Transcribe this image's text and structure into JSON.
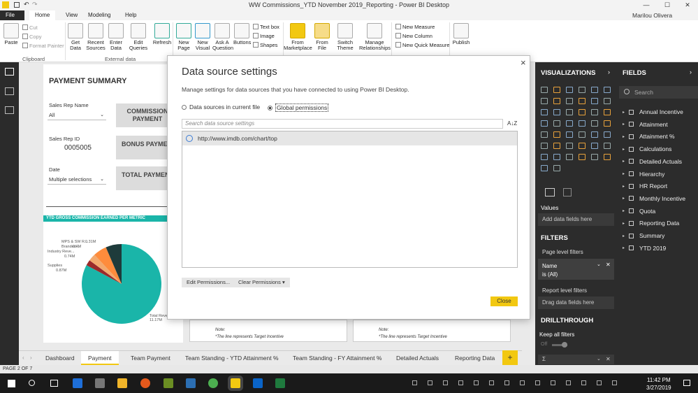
{
  "window": {
    "title": "WW Commissions_YTD November 2019_Reporting - Power BI Desktop",
    "user": "Marilou Olivera",
    "controls": [
      "—",
      "☐",
      "✕"
    ]
  },
  "menu": {
    "tabs": [
      "File",
      "Home",
      "View",
      "Modeling",
      "Help"
    ]
  },
  "ribbon": {
    "clipboard": {
      "paste": "Paste",
      "cut": "Cut",
      "copy": "Copy",
      "format_painter": "Format Painter",
      "group": "Clipboard"
    },
    "external": {
      "get_data": "Get Data",
      "recent_sources": "Recent Sources",
      "enter_data": "Enter Data",
      "edit_queries": "Edit Queries",
      "refresh": "Refresh",
      "group": "External data"
    },
    "insert": {
      "new_page": "New Page",
      "new_visual": "New Visual",
      "ask_question": "Ask A Question",
      "buttons": "Buttons",
      "text_box": "Text box",
      "image": "Image",
      "shapes": "Shapes"
    },
    "custom": {
      "from_marketplace": "From Marketplace",
      "from_file": "From File",
      "switch_theme": "Switch Theme",
      "manage_relationships": "Manage Relationships"
    },
    "calc": {
      "new_measure": "New Measure",
      "new_column": "New Column",
      "new_quick_measure": "New Quick Measure"
    },
    "share": {
      "publish": "Publish"
    }
  },
  "report": {
    "title": "PAYMENT SUMMARY",
    "sales_rep_name_label": "Sales Rep Name",
    "sales_rep_name_value": "All",
    "sales_rep_id_label": "Sales Rep ID",
    "sales_rep_id_value": "0005005",
    "date_label": "Date",
    "date_value": "Multiple selections",
    "commission_payment": "COMMISSION PAYMENT",
    "bonus_payment": "BONUS PAYMENT",
    "total_payment": "TOTAL PAYMENT",
    "note1": "Note:",
    "note1_text": "*The line represents Target  Incentive",
    "note2": "Note:",
    "note2_text": "*The line represents Target  Incentive"
  },
  "chart_data": {
    "type": "pie",
    "title": "YTD GROSS COMMISSION EARNED PER METRIC",
    "labels": [
      "MPS & SW R...",
      "Branded...",
      "Industry Reve...",
      "Supplies",
      "Total Reve..."
    ],
    "value_labels": [
      "0.31M",
      "0.4M",
      "0.74M",
      "0.87M",
      "11.17M"
    ],
    "values": [
      0.31,
      0.4,
      0.74,
      0.87,
      11.17
    ],
    "colors": {
      "total": "#1ab5a9",
      "supplies": "#1e3b3b",
      "industry": "#fe8c3c",
      "branded": "#f2a96e",
      "mps": "#9b2a2a"
    }
  },
  "dialog": {
    "title": "Data source settings",
    "subtitle": "Manage settings for data sources that you have connected to using Power BI Desktop.",
    "radio_current": "Data sources in current file",
    "radio_global": "Global permissions",
    "search_placeholder": "Search data source settings",
    "sort_label": "A↓Z",
    "source": "http://www.imdb.com/chart/top",
    "edit_permissions": "Edit Permissions...",
    "clear_permissions": "Clear Permissions",
    "close": "Close"
  },
  "viz": {
    "header": "VISUALIZATIONS",
    "values": "Values",
    "add_fields": "Add data fields here",
    "filters": "FILTERS",
    "page_filters": "Page level filters",
    "filter_name": "Name",
    "filter_value": "is (All)",
    "report_filters": "Report level filters",
    "drag_fields": "Drag data fields here",
    "drillthrough": "DRILLTHROUGH",
    "keep_all": "Keep all filters",
    "keep_state": "Off",
    "sigma": "Σ"
  },
  "fields": {
    "header": "FIELDS",
    "search_placeholder": "Search",
    "items": [
      "Annual Incentive",
      "Attainment",
      "Attainment %",
      "Calculations",
      "Detailed Actuals",
      "Hierarchy",
      "HR Report",
      "Monthly Incentive",
      "Quota",
      "Reporting Data",
      "Summary",
      "YTD 2019"
    ]
  },
  "pages": {
    "tabs": [
      "Dashboard",
      "Payment",
      "Team Payment",
      "Team Standing - YTD Attainment %",
      "Team Standing - FY Attainment %",
      "Detailed Actuals",
      "Reporting Data"
    ],
    "add": "+",
    "status": "PAGE 2 OF 7"
  },
  "taskbar": {
    "time": "11:42 PM",
    "date": "3/27/2019"
  },
  "colors": {
    "accent": "#f2c811",
    "pane": "#2c2c2c",
    "teal": "#1ab5a9"
  }
}
